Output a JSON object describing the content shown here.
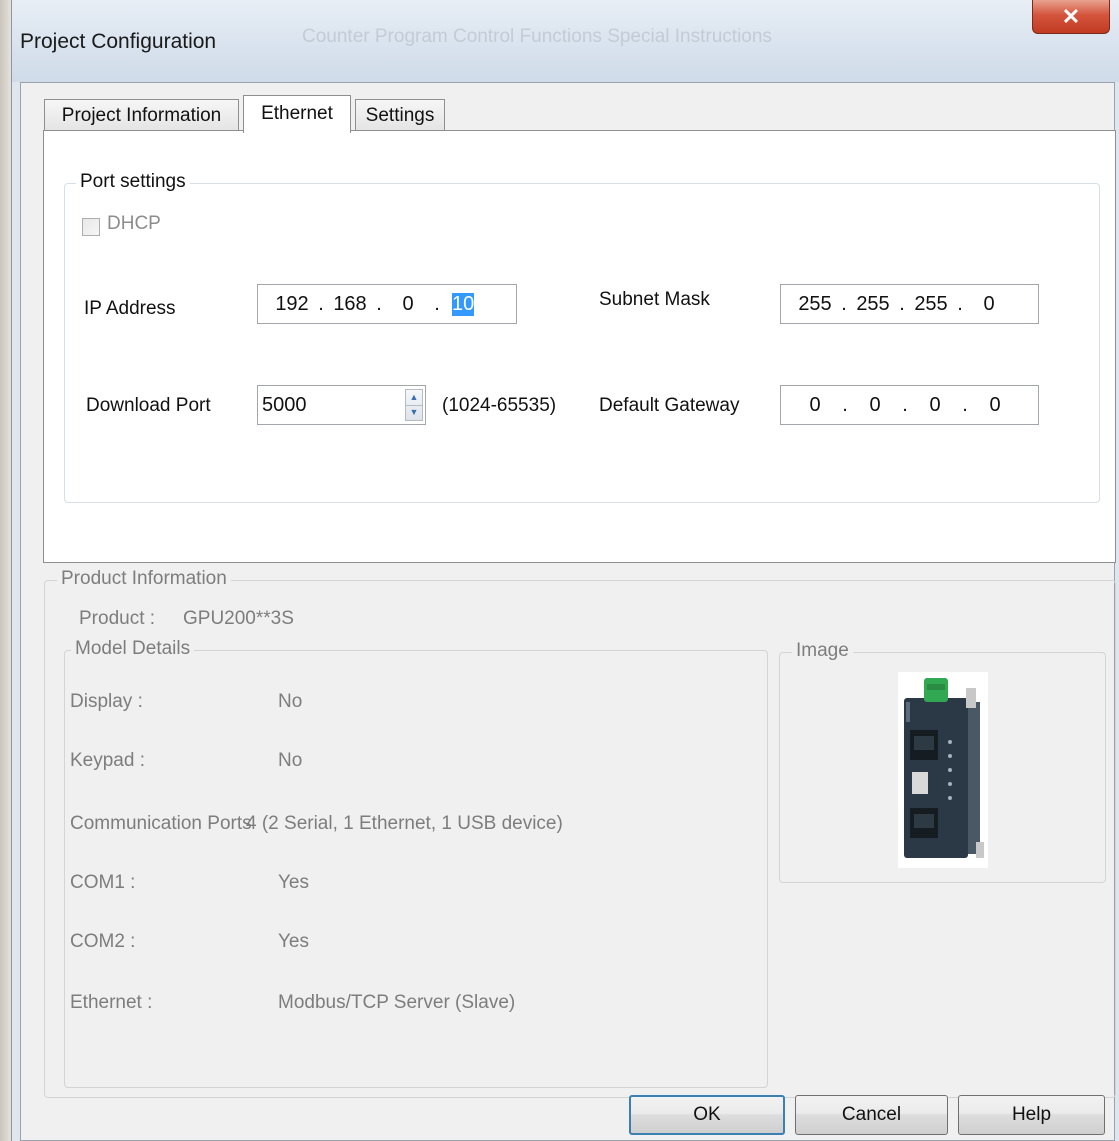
{
  "window": {
    "title": "Project Configuration",
    "background_menu_text": "Counter   Program Control   Functions   Special Instructions"
  },
  "tabs": [
    {
      "label": "Project Information",
      "active": false
    },
    {
      "label": "Ethernet",
      "active": true
    },
    {
      "label": "Settings",
      "active": false
    }
  ],
  "port_settings": {
    "legend": "Port settings",
    "dhcp": {
      "label": "DHCP",
      "checked": false,
      "enabled": false
    },
    "ip_address": {
      "label": "IP Address",
      "octets": [
        "192",
        "168",
        "0",
        "10"
      ],
      "selected_octet": 3
    },
    "subnet_mask": {
      "label": "Subnet Mask",
      "octets": [
        "255",
        "255",
        "255",
        "0"
      ]
    },
    "download_port": {
      "label": "Download Port",
      "value": "5000",
      "range": "(1024-65535)"
    },
    "default_gateway": {
      "label": "Default Gateway",
      "octets": [
        "0",
        "0",
        "0",
        "0"
      ]
    }
  },
  "product_information": {
    "legend": "Product Information",
    "product_label": "Product :",
    "product_value": "GPU200**3S",
    "model_details": {
      "legend": "Model Details",
      "rows": [
        {
          "label": "Display :",
          "value": "No"
        },
        {
          "label": "Keypad :",
          "value": "No"
        },
        {
          "label": "Communication Ports",
          "value": "4 (2 Serial,  1 Ethernet, 1 USB device)"
        },
        {
          "label": "COM1 :",
          "value": "Yes"
        },
        {
          "label": "COM2 :",
          "value": "Yes"
        },
        {
          "label": "Ethernet :",
          "value": "Modbus/TCP Server (Slave)"
        }
      ]
    },
    "image_legend": "Image"
  },
  "buttons": {
    "ok": "OK",
    "cancel": "Cancel",
    "help": "Help"
  },
  "icons": {
    "close": "close-icon",
    "spin_up": "spin-up-icon",
    "spin_down": "spin-down-icon"
  },
  "colors": {
    "close_button": "#c8452c",
    "selection": "#3399ff",
    "ok_border": "#3c7fb1",
    "disabled_text": "#7d7d7d"
  }
}
